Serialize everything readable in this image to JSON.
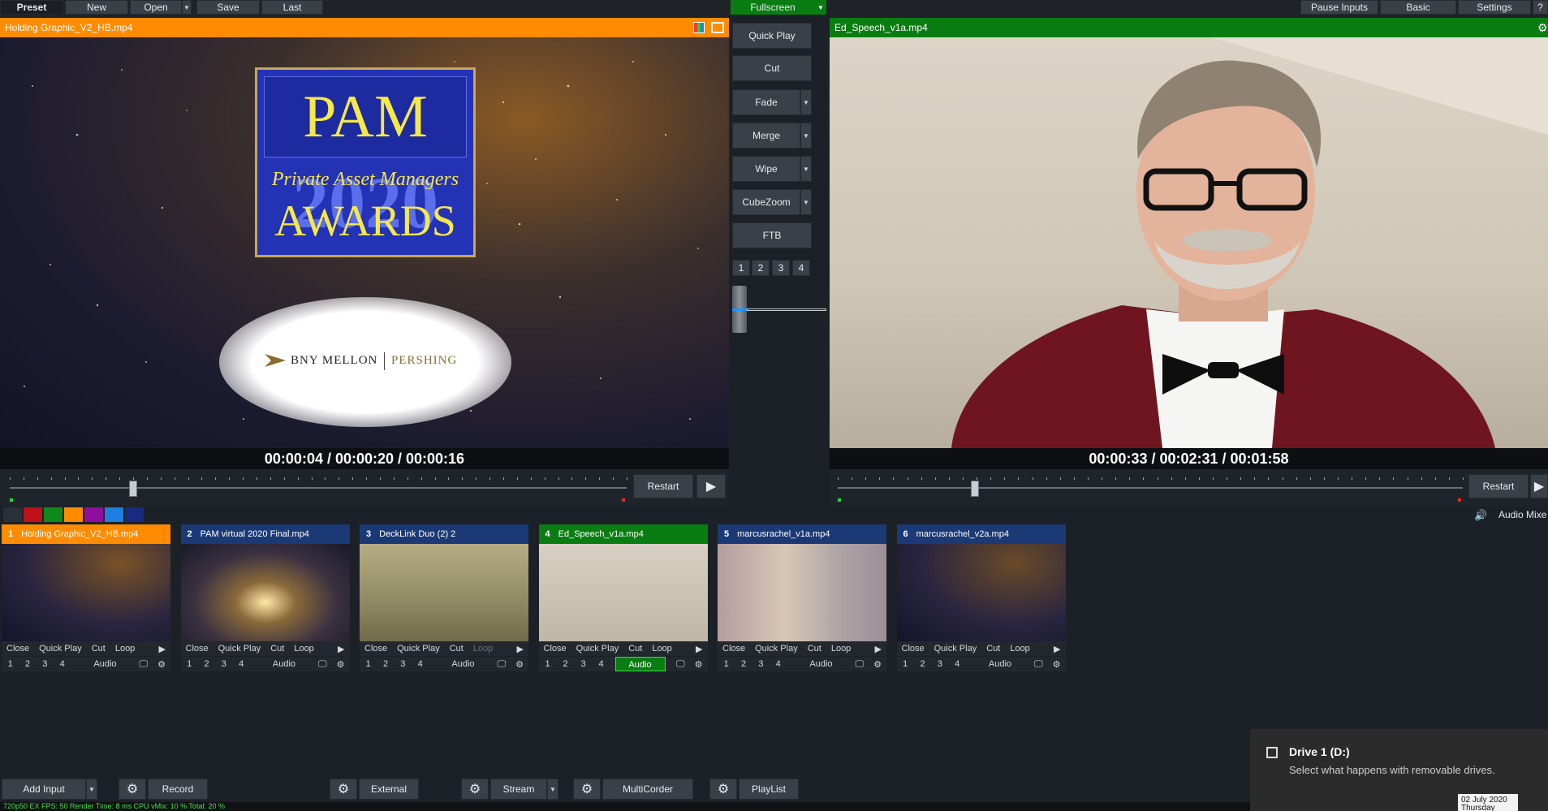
{
  "topbar": {
    "preset": "Preset",
    "new": "New",
    "open": "Open",
    "save": "Save",
    "last": "Last",
    "fullscreen": "Fullscreen",
    "pause_inputs": "Pause Inputs",
    "basic": "Basic",
    "settings": "Settings"
  },
  "preview": {
    "title": "Holding Graphic_V2_HB.mp4",
    "timecode": "00:00:04  /  00:00:20  /  00:00:16",
    "restart": "Restart",
    "graphic": {
      "pam": "PAM",
      "subtitle": "Private Asset Managers",
      "awards": "AWARDS",
      "year": "2020",
      "sponsor_left": "BNY MELLON",
      "sponsor_right": "PERSHING"
    },
    "progress": 0.2
  },
  "output": {
    "title": "Ed_Speech_v1a.mp4",
    "timecode": "00:00:33  /  00:02:31  /  00:01:58",
    "restart": "Restart",
    "progress": 0.22,
    "audio_mixer": "Audio Mixe"
  },
  "transitions": {
    "quick_play": "Quick Play",
    "cut": "Cut",
    "fade": "Fade",
    "merge": "Merge",
    "wipe": "Wipe",
    "cubezoom": "CubeZoom",
    "ftb": "FTB",
    "numbers": [
      "1",
      "2",
      "3",
      "4"
    ]
  },
  "color_swatches": [
    "#2a3038",
    "#c0101a",
    "#0f8a1a",
    "#ff8c00",
    "#8e0f9e",
    "#1e7fe0",
    "#1a2a80"
  ],
  "inputs": [
    {
      "num": "1",
      "name": "Holding Graphic_V2_HB.mp4",
      "state": "preview",
      "loop_enabled": true,
      "audio_active": false
    },
    {
      "num": "2",
      "name": "PAM virtual 2020 Final.mp4",
      "state": "idle",
      "loop_enabled": true,
      "audio_active": false
    },
    {
      "num": "3",
      "name": "DeckLink Duo (2) 2",
      "state": "idle",
      "loop_enabled": false,
      "audio_active": false
    },
    {
      "num": "4",
      "name": "Ed_Speech_v1a.mp4",
      "state": "active",
      "loop_enabled": true,
      "audio_active": true
    },
    {
      "num": "5",
      "name": "marcusrachel_v1a.mp4",
      "state": "idle",
      "loop_enabled": true,
      "audio_active": false
    },
    {
      "num": "6",
      "name": "marcusrachel_v2a.mp4",
      "state": "idle",
      "loop_enabled": true,
      "audio_active": false
    }
  ],
  "tile_labels": {
    "close": "Close",
    "quick_play": "Quick Play",
    "cut": "Cut",
    "loop": "Loop",
    "audio": "Audio",
    "numbers": [
      "1",
      "2",
      "3",
      "4"
    ]
  },
  "bottombar": {
    "add_input": "Add Input",
    "record": "Record",
    "external": "External",
    "stream": "Stream",
    "multicorder": "MultiCorder",
    "playlist": "PlayList"
  },
  "status": {
    "text": "720p50    EX  FPS: 50  Render Time: 8 ms  CPU vMix: 10 %  Total: 20 %"
  },
  "notification": {
    "title": "Drive 1 (D:)",
    "body": "Select what happens with removable drives.",
    "date": "02 July 2020",
    "day": "Thursday"
  },
  "colors": {
    "preview_orange": "#ff8c00",
    "active_green": "#0a7d12",
    "idle_blue": "#1b3a75"
  }
}
